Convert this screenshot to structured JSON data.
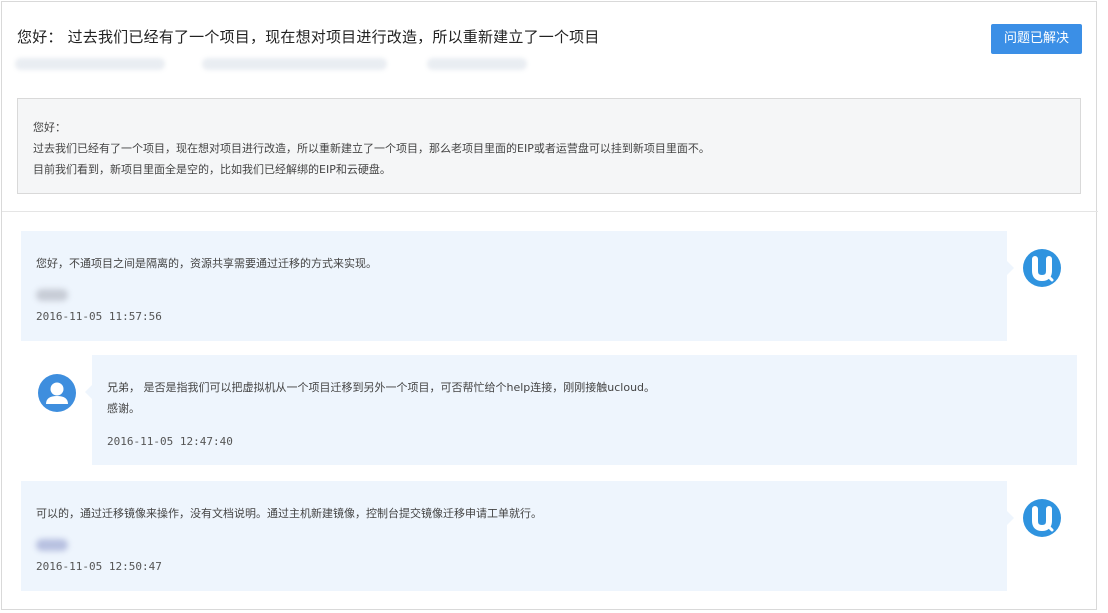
{
  "ticket": {
    "title": "您好： 过去我们已经有了一个项目，现在想对项目进行改造，所以重新建立了一个项目",
    "resolve_button": "问题已解决",
    "description": [
      "您好：",
      "过去我们已经有了一个项目，现在想对项目进行改造，所以重新建立了一个项目，那么老项目里面的EIP或者运营盘可以挂到新项目里面不。",
      "目前我们看到，新项目里面全是空的，比如我们已经解绑的EIP和云硬盘。"
    ]
  },
  "messages": [
    {
      "author": "staff",
      "text": "您好，不通项目之间是隔离的，资源共享需要通过迁移的方式来实现。",
      "time": "2016-11-05 11:57:56"
    },
    {
      "author": "user",
      "text": "兄弟， 是否是指我们可以把虚拟机从一个项目迁移到另外一个项目，可否帮忙给个help连接，刚刚接触ucloud。\n感谢。",
      "time": "2016-11-05 12:47:40"
    },
    {
      "author": "staff",
      "text": "可以的，通过迁移镜像来操作，没有文档说明。通过主机新建镜像，控制台提交镜像迁移申请工单就行。",
      "time": "2016-11-05 12:50:47"
    }
  ],
  "colors": {
    "accent": "#3b8fe6",
    "message_bg": "#eef5fd",
    "description_bg": "#f5f6f7"
  },
  "icons": {
    "staff_avatar": "ucloud-u-icon",
    "user_avatar": "user-silhouette-icon",
    "cursor": "mouse-pointer-icon"
  }
}
